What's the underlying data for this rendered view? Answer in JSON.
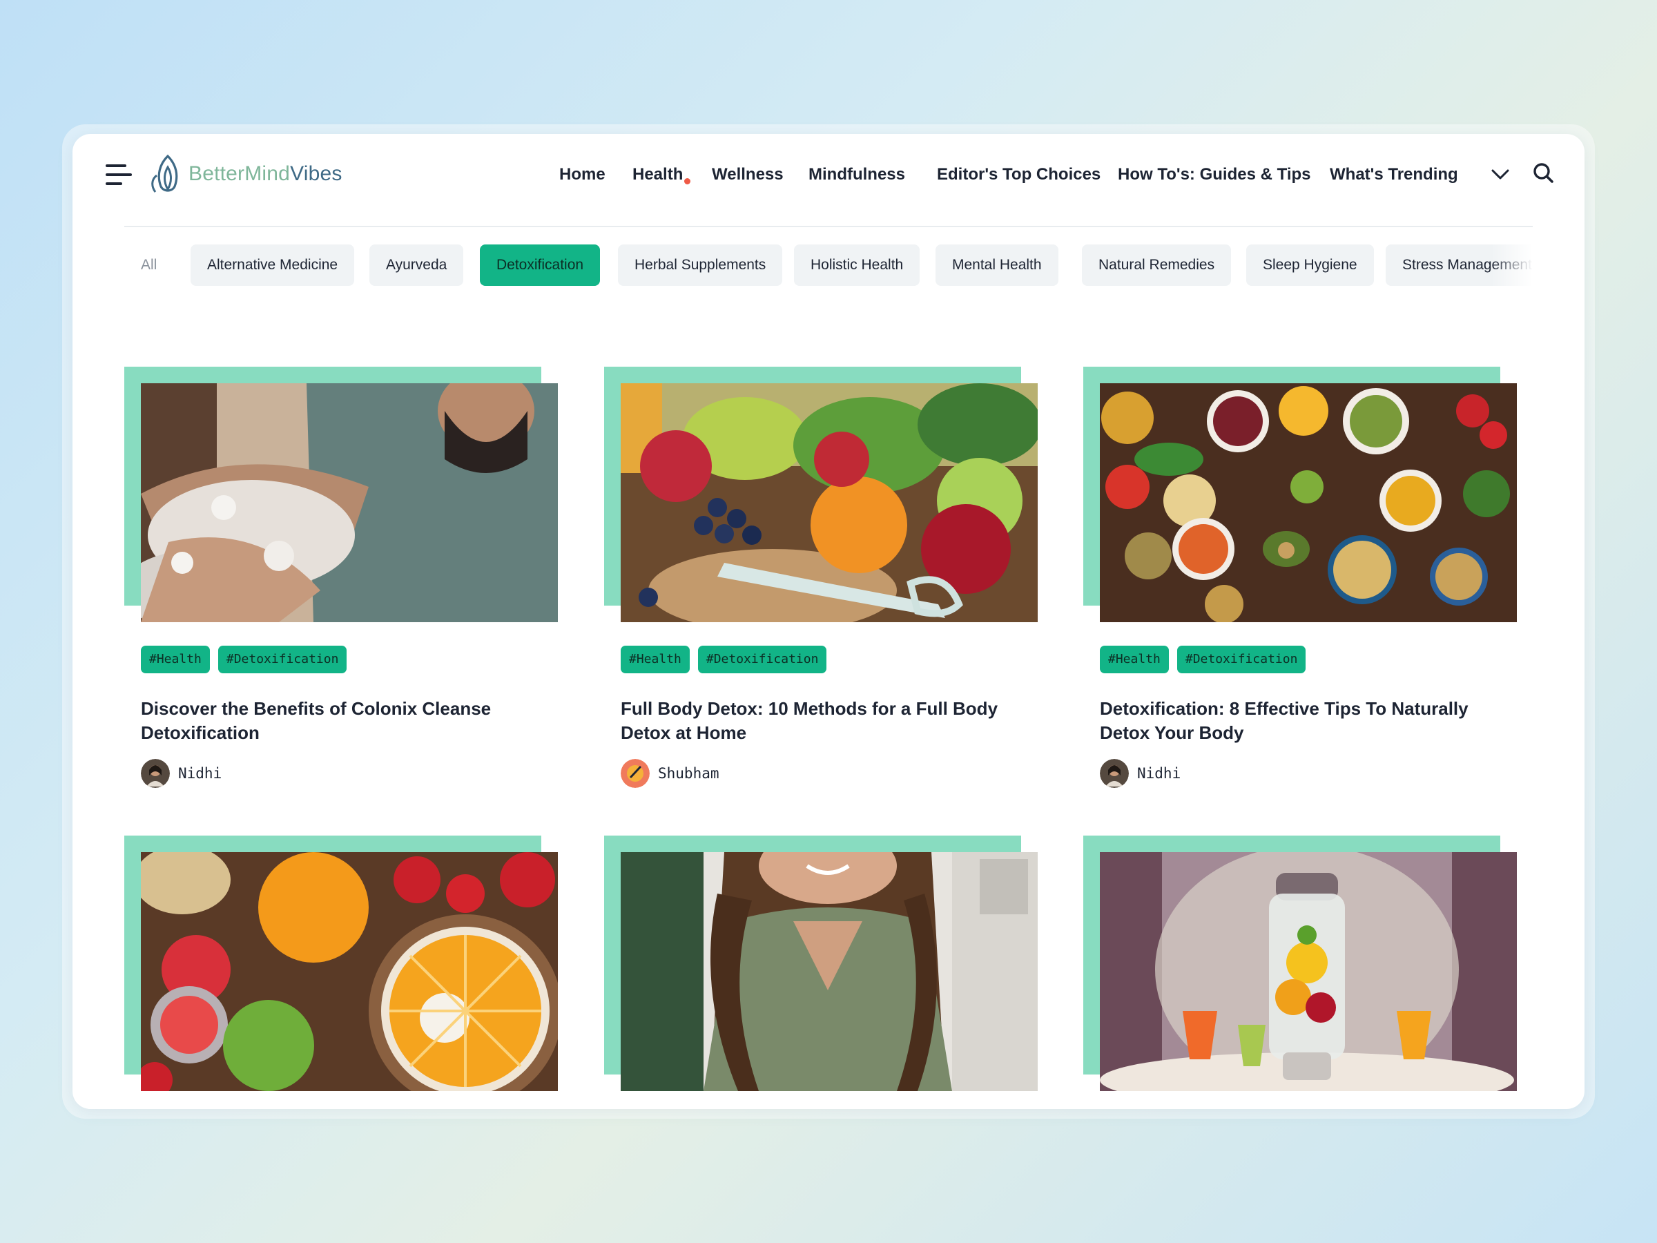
{
  "brand": {
    "name_part1": "BetterMind",
    "name_part2": "Vibes"
  },
  "nav": {
    "items": [
      {
        "label": "Home"
      },
      {
        "label": "Health"
      },
      {
        "label": "Wellness"
      },
      {
        "label": "Mindfulness"
      },
      {
        "label": "Editor's Top Choices"
      },
      {
        "label": "How To's: Guides & Tips"
      },
      {
        "label": "What's Trending"
      }
    ],
    "notification_color": "#ef5a46"
  },
  "categories": {
    "items": [
      {
        "label": "All"
      },
      {
        "label": "Alternative Medicine"
      },
      {
        "label": "Ayurveda"
      },
      {
        "label": "Detoxification"
      },
      {
        "label": "Herbal Supplements"
      },
      {
        "label": "Holistic Health"
      },
      {
        "label": "Mental Health"
      },
      {
        "label": "Natural Remedies"
      },
      {
        "label": "Sleep Hygiene"
      },
      {
        "label": "Stress Management"
      }
    ],
    "active": "Detoxification",
    "accent_color": "#12b487"
  },
  "cards": [
    {
      "image": "man-washing-arm-with-foam",
      "tags": [
        "#Health",
        "#Detoxification"
      ],
      "title": "Discover the Benefits of Colonix Cleanse Detoxification",
      "author": "Nidhi"
    },
    {
      "image": "fruits-vegetables-measuring-tape",
      "tags": [
        "#Health",
        "#Detoxification"
      ],
      "title": "Full Body Detox: 10 Methods for a Full Body Detox at Home",
      "author": "Shubham"
    },
    {
      "image": "bowls-of-spices-and-vegetables",
      "tags": [
        "#Health",
        "#Detoxification"
      ],
      "title": "Detoxification: 8 Effective Tips To Naturally Detox Your Body",
      "author": "Nidhi"
    },
    {
      "image": "citrus-fruits-and-strawberries"
    },
    {
      "image": "smiling-woman-in-green-blouse"
    },
    {
      "image": "blender-with-juices"
    }
  ],
  "colors": {
    "card_frame": "#88dcc0",
    "text": "#1d2433"
  }
}
